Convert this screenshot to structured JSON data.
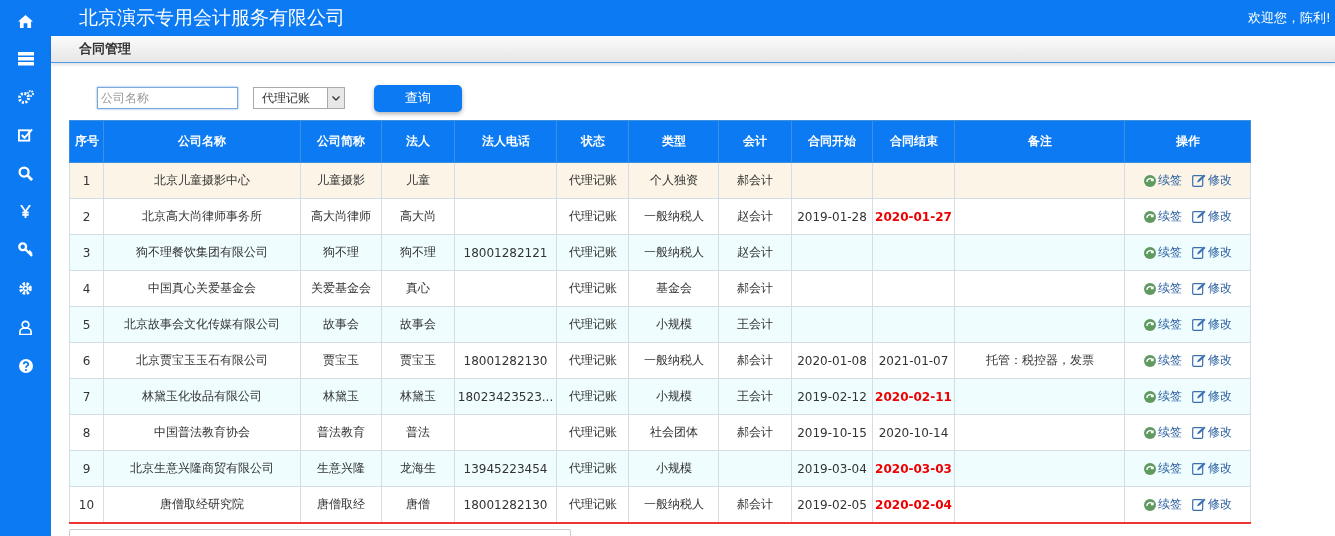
{
  "header": {
    "title": "北京演示专用会计服务有限公司",
    "welcome": "欢迎您，陈利!"
  },
  "breadcrumb": "合同管理",
  "search": {
    "placeholder": "公司名称",
    "type_select": "代理记账",
    "button": "查询"
  },
  "table": {
    "columns": [
      "序号",
      "公司名称",
      "公司简称",
      "法人",
      "法人电话",
      "状态",
      "类型",
      "会计",
      "合同开始",
      "合同结束",
      "备注",
      "操作"
    ],
    "rows": [
      {
        "selected": true,
        "cells": [
          "1",
          "北京儿童摄影中心",
          "儿童摄影",
          "儿童",
          "",
          "代理记账",
          "个人独资",
          "郝会计",
          "",
          "",
          ""
        ],
        "actions": [
          {
            "kind": "renew",
            "label": "续签"
          },
          {
            "kind": "edit",
            "label": "修改"
          }
        ]
      },
      {
        "selected": false,
        "cells": [
          "2",
          "北京高大尚律师事务所",
          "高大尚律师",
          "高大尚",
          "",
          "代理记账",
          "一般纳税人",
          "赵会计",
          "2019-01-28",
          "2020-01-27",
          ""
        ],
        "expired": true,
        "actions": [
          {
            "kind": "renew",
            "label": "续签"
          },
          {
            "kind": "edit",
            "label": "修改"
          }
        ]
      },
      {
        "selected": false,
        "cells": [
          "3",
          "狗不理餐饮集团有限公司",
          "狗不理",
          "狗不理",
          "18001282121",
          "代理记账",
          "一般纳税人",
          "赵会计",
          "",
          "",
          ""
        ],
        "actions": [
          {
            "kind": "renew",
            "label": "续签"
          },
          {
            "kind": "edit",
            "label": "修改"
          }
        ]
      },
      {
        "selected": false,
        "cells": [
          "4",
          "中国真心关爱基金会",
          "关爱基金会",
          "真心",
          "",
          "代理记账",
          "基金会",
          "郝会计",
          "",
          "",
          ""
        ],
        "actions": [
          {
            "kind": "renew",
            "label": "续签"
          },
          {
            "kind": "edit",
            "label": "修改"
          }
        ]
      },
      {
        "selected": false,
        "cells": [
          "5",
          "北京故事会文化传媒有限公司",
          "故事会",
          "故事会",
          "",
          "代理记账",
          "小规模",
          "王会计",
          "",
          "",
          ""
        ],
        "actions": [
          {
            "kind": "renew",
            "label": "续签"
          },
          {
            "kind": "edit",
            "label": "修改"
          }
        ]
      },
      {
        "selected": false,
        "cells": [
          "6",
          "北京贾宝玉玉石有限公司",
          "贾宝玉",
          "贾宝玉",
          "18001282130",
          "代理记账",
          "一般纳税人",
          "郝会计",
          "2020-01-08",
          "2021-01-07",
          "托管：税控器，发票"
        ],
        "expired": false,
        "actions": [
          {
            "kind": "renew",
            "label": "续签"
          },
          {
            "kind": "edit",
            "label": "修改"
          }
        ]
      },
      {
        "selected": false,
        "cells": [
          "7",
          "林黛玉化妆品有限公司",
          "林黛玉",
          "林黛玉",
          "18023423523...",
          "代理记账",
          "小规模",
          "王会计",
          "2019-02-12",
          "2020-02-11",
          ""
        ],
        "expired": true,
        "actions": [
          {
            "kind": "renew",
            "label": "续签"
          },
          {
            "kind": "edit",
            "label": "修改"
          }
        ]
      },
      {
        "selected": false,
        "cells": [
          "8",
          "中国普法教育协会",
          "普法教育",
          "普法",
          "",
          "代理记账",
          "社会团体",
          "郝会计",
          "2019-10-15",
          "2020-10-14",
          ""
        ],
        "expired": false,
        "actions": [
          {
            "kind": "renew",
            "label": "续签"
          },
          {
            "kind": "edit",
            "label": "修改"
          }
        ]
      },
      {
        "selected": false,
        "cells": [
          "9",
          "北京生意兴隆商贸有限公司",
          "生意兴隆",
          "龙海生",
          "13945223454",
          "代理记账",
          "小规模",
          "",
          "2019-03-04",
          "2020-03-03",
          ""
        ],
        "expired": true,
        "actions": [
          {
            "kind": "renew",
            "label": "续签"
          },
          {
            "kind": "edit",
            "label": "修改"
          }
        ]
      },
      {
        "selected": false,
        "cells": [
          "10",
          "唐僧取经研究院",
          "唐僧取经",
          "唐僧",
          "18001282130",
          "代理记账",
          "一般纳税人",
          "郝会计",
          "2019-02-05",
          "2020-02-04",
          ""
        ],
        "expired": true,
        "actions": [
          {
            "kind": "renew",
            "label": "续签"
          },
          {
            "kind": "edit",
            "label": "修改"
          }
        ]
      }
    ]
  }
}
